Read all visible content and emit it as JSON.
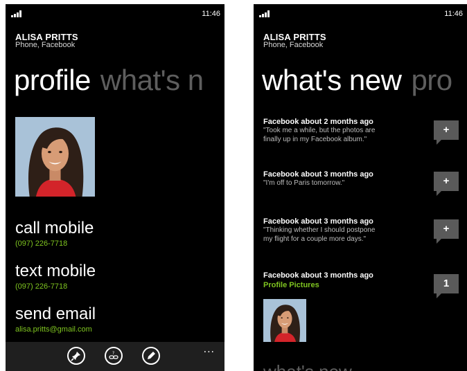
{
  "left_phone": {
    "status": {
      "time": "11:46"
    },
    "contact": {
      "name": "ALISA PRITTS",
      "subtitle": "Phone, Facebook"
    },
    "pivot": {
      "active": "profile",
      "next": "what's n"
    },
    "actions": [
      {
        "label": "call mobile",
        "value": "(097) 226-7718"
      },
      {
        "label": "text mobile",
        "value": "(097) 226-7718"
      },
      {
        "label": "send email",
        "value": "alisa.pritts@gmail.com"
      }
    ],
    "app_bar": {
      "buttons": [
        "pin-icon",
        "link-icon",
        "edit-icon"
      ],
      "more": "..."
    }
  },
  "right_phone": {
    "status": {
      "time": "11:46"
    },
    "contact": {
      "name": "ALISA PRITTS",
      "subtitle": "Phone, Facebook"
    },
    "pivot": {
      "active": "what's new",
      "next": "pro"
    },
    "feed": [
      {
        "title": "Facebook about 2 months ago",
        "text_lines": [
          "\"Took me a while, but the photos are",
          "finally up in my Facebook album.\""
        ],
        "comments": "+"
      },
      {
        "title": "Facebook about 3 months ago",
        "text_lines": [
          "\"I'm off to Paris tomorrow.\""
        ],
        "comments": "+"
      },
      {
        "title": "Facebook about 3 months ago",
        "text_lines": [
          "\"Thinking whether I should postpone",
          "my flight for a couple more days.\""
        ],
        "comments": "+"
      },
      {
        "title": "Facebook about 3 months ago",
        "link": "Profile Pictures",
        "comments": "1"
      }
    ],
    "bottom_peek": "what's new"
  },
  "colors": {
    "background": "#000000",
    "accent": "#7fc520",
    "inactive": "#5e5e5e",
    "app_bar": "#1f1f1f",
    "bubble": "#5a5a5a"
  }
}
